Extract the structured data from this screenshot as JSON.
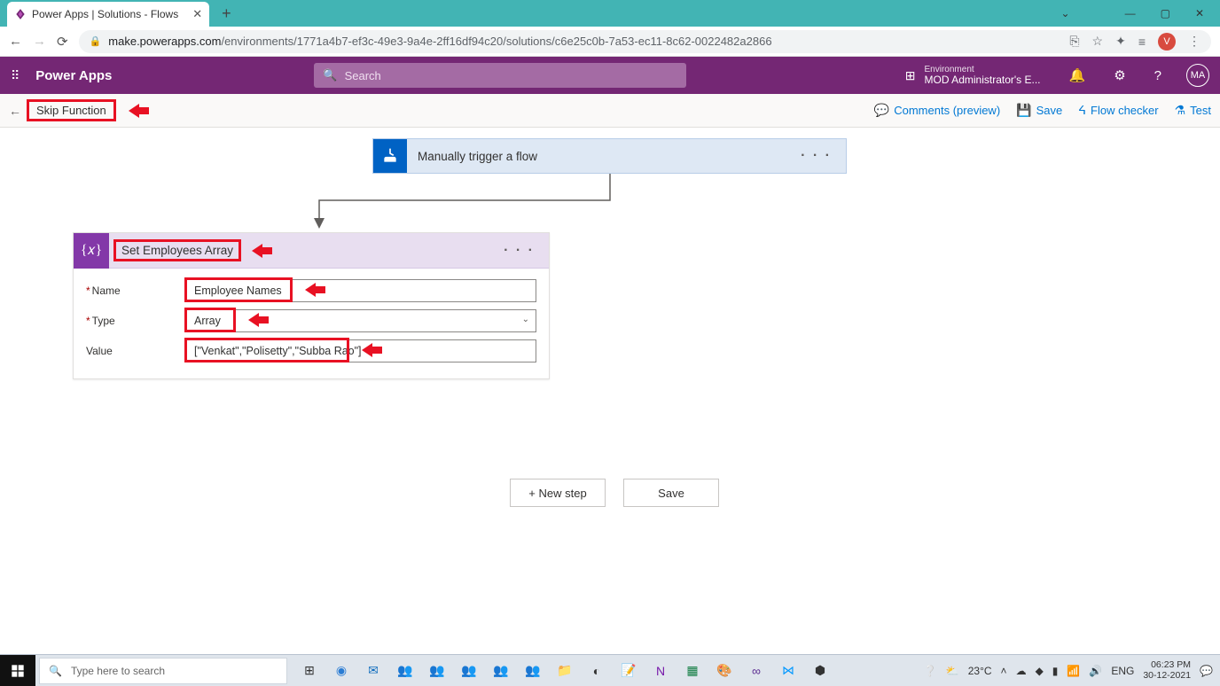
{
  "browser": {
    "tab_title": "Power Apps | Solutions - Flows",
    "url_host": "make.powerapps.com",
    "url_path": "/environments/1771a4b7-ef3c-49e3-9a4e-2ff16df94c20/solutions/c6e25c0b-7a53-ec11-8c62-0022482a2866",
    "profile_initial": "V"
  },
  "app": {
    "name": "Power Apps",
    "search_placeholder": "Search",
    "env_label": "Environment",
    "env_value": "MOD Administrator's E...",
    "user_initials": "MA"
  },
  "cmdbar": {
    "flow_title": "Skip Function",
    "comments": "Comments (preview)",
    "save": "Save",
    "flow_checker": "Flow checker",
    "test": "Test"
  },
  "trigger": {
    "label": "Manually trigger a flow"
  },
  "action": {
    "title": "Set Employees Array",
    "name_label": "Name",
    "name_value": "Employee Names",
    "type_label": "Type",
    "type_value": "Array",
    "value_label": "Value",
    "value_value": "[\"Venkat\",\"Polisetty\",\"Subba Rao\"]"
  },
  "buttons": {
    "new_step": "+ New step",
    "save": "Save"
  },
  "taskbar": {
    "search_placeholder": "Type here to search",
    "temp": "23°C",
    "lang": "ENG",
    "time": "06:23 PM",
    "date": "30-12-2021"
  }
}
